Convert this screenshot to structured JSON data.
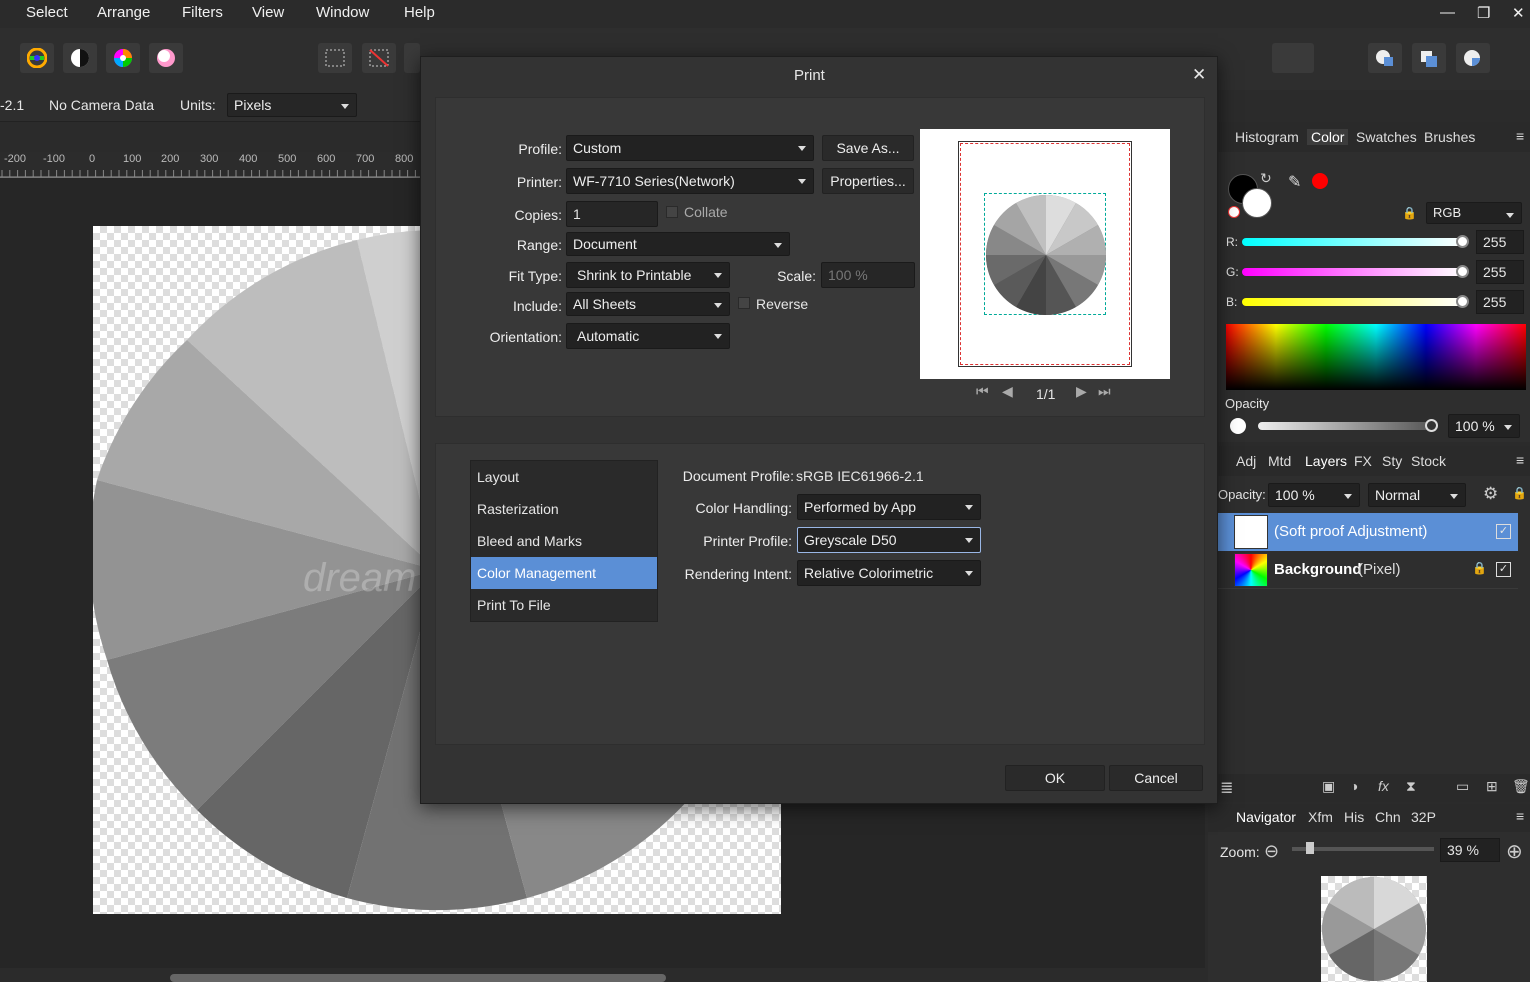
{
  "menu": [
    "Select",
    "Arrange",
    "Filters",
    "View",
    "Window",
    "Help"
  ],
  "context_bar": {
    "doc_suffix": "-2.1",
    "camera": "No Camera Data",
    "units_label": "Units:",
    "units_value": "Pixels"
  },
  "ruler": {
    "ticks": [
      "-200",
      "-100",
      "0",
      "100",
      "200",
      "300",
      "400",
      "500",
      "600",
      "700",
      "800"
    ]
  },
  "watermark": "dream",
  "dialog": {
    "title": "Print",
    "profile_label": "Profile:",
    "profile_value": "Custom",
    "save_as": "Save As...",
    "printer_label": "Printer:",
    "printer_value": "WF-7710 Series(Network)",
    "properties": "Properties...",
    "copies_label": "Copies:",
    "copies_value": "1",
    "collate": "Collate",
    "range_label": "Range:",
    "range_value": "Document",
    "fit_label": "Fit Type:",
    "fit_value": "Shrink to Printable",
    "scale_label": "Scale:",
    "scale_value": "100 %",
    "include_label": "Include:",
    "include_value": "All Sheets",
    "reverse": "Reverse",
    "orientation_label": "Orientation:",
    "orientation_value": "Automatic",
    "page_indicator": "1/1",
    "nav_items": [
      "Layout",
      "Rasterization",
      "Bleed and Marks",
      "Color Management",
      "Print To File"
    ],
    "selected_nav": "Color Management",
    "doc_profile_label": "Document Profile:",
    "doc_profile_value": "sRGB IEC61966-2.1",
    "color_handling_label": "Color Handling:",
    "color_handling_value": "Performed by App",
    "printer_profile_label": "Printer Profile:",
    "printer_profile_value": "Greyscale D50",
    "intent_label": "Rendering Intent:",
    "intent_value": "Relative Colorimetric",
    "ok": "OK",
    "cancel": "Cancel"
  },
  "color_panel": {
    "tabs": [
      "Histogram",
      "Color",
      "Swatches",
      "Brushes"
    ],
    "active_tab": "Color",
    "mode": "RGB",
    "channels": [
      {
        "label": "R:",
        "value": "255"
      },
      {
        "label": "G:",
        "value": "255"
      },
      {
        "label": "B:",
        "value": "255"
      }
    ],
    "opacity_label": "Opacity",
    "opacity_value": "100 %",
    "primary_color": "#000000",
    "secondary_color": "#ffffff",
    "accent_red": "#ff0000"
  },
  "layers_panel": {
    "tabs": [
      "Adj",
      "Mtd",
      "Layers",
      "FX",
      "Sty",
      "Stock"
    ],
    "active_tab": "Layers",
    "opacity_label": "Opacity:",
    "opacity_value": "100 %",
    "blend_mode": "Normal",
    "layers": [
      {
        "name": "(Soft proof Adjustment)",
        "type": ""
      },
      {
        "name": "Background",
        "type": "(Pixel)"
      }
    ]
  },
  "navigator_panel": {
    "tabs": [
      "Navigator",
      "Xfm",
      "His",
      "Chn",
      "32P"
    ],
    "active_tab": "Navigator",
    "zoom_label": "Zoom:",
    "zoom_value": "39 %"
  },
  "colors": {
    "accent": "#5b8fd6",
    "dialog_bg": "#333333",
    "selection": "#5b8fd6"
  }
}
